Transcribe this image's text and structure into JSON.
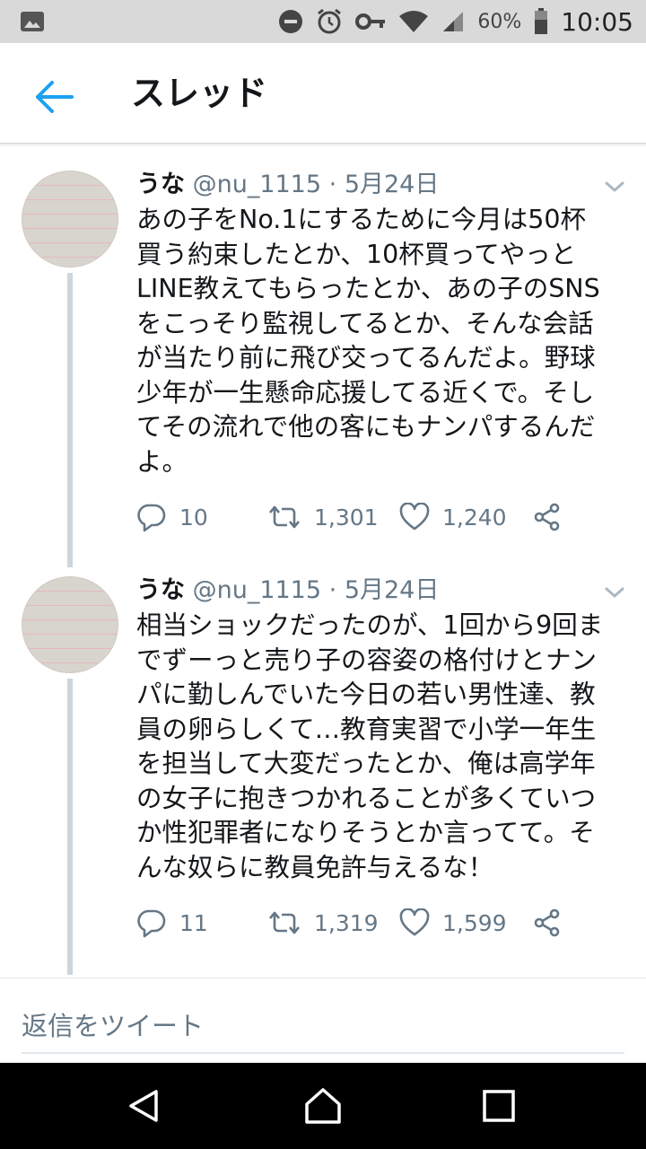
{
  "status_bar": {
    "battery_percent": "60%",
    "time": "10:05"
  },
  "header": {
    "title": "スレッド"
  },
  "tweets": [
    {
      "name": "うな",
      "handle": "@nu_1115",
      "separator": "·",
      "date": "5月24日",
      "lines": [
        "あの子をNo.1にするために今月は50杯",
        "買う約束したとか、10杯買ってやっと",
        "LINE教えてもらったとか、あの子のSNS",
        "をこっそり監視してるとか、そんな会話",
        "が当たり前に飛び交ってるんだよ。野球",
        "少年が一生懸命応援してる近くで。そし",
        "てその流れで他の客にもナンパするんだ",
        "よ。"
      ],
      "replies": "10",
      "retweets": "1,301",
      "likes": "1,240"
    },
    {
      "name": "うな",
      "handle": "@nu_1115",
      "separator": "·",
      "date": "5月24日",
      "lines": [
        "相当ショックだったのが、1回から9回ま",
        "でずーっと売り子の容姿の格付けとナン",
        "パに勤しんでいた今日の若い男性達、教",
        "員の卵らしくて…教育実習で小学一年生",
        "を担当して大変だったとか、俺は高学年",
        "の女子に抱きつかれることが多くていつ",
        "か性犯罪者になりそうとか言ってて。そ",
        "んな奴らに教員免許与えるな！"
      ],
      "replies": "11",
      "retweets": "1,319",
      "likes": "1,599"
    }
  ],
  "reply_bar": {
    "placeholder": "返信をツイート"
  },
  "colors": {
    "accent": "#1da1f2",
    "secondary_text": "#657786",
    "thread_line": "#ccd6dd"
  }
}
